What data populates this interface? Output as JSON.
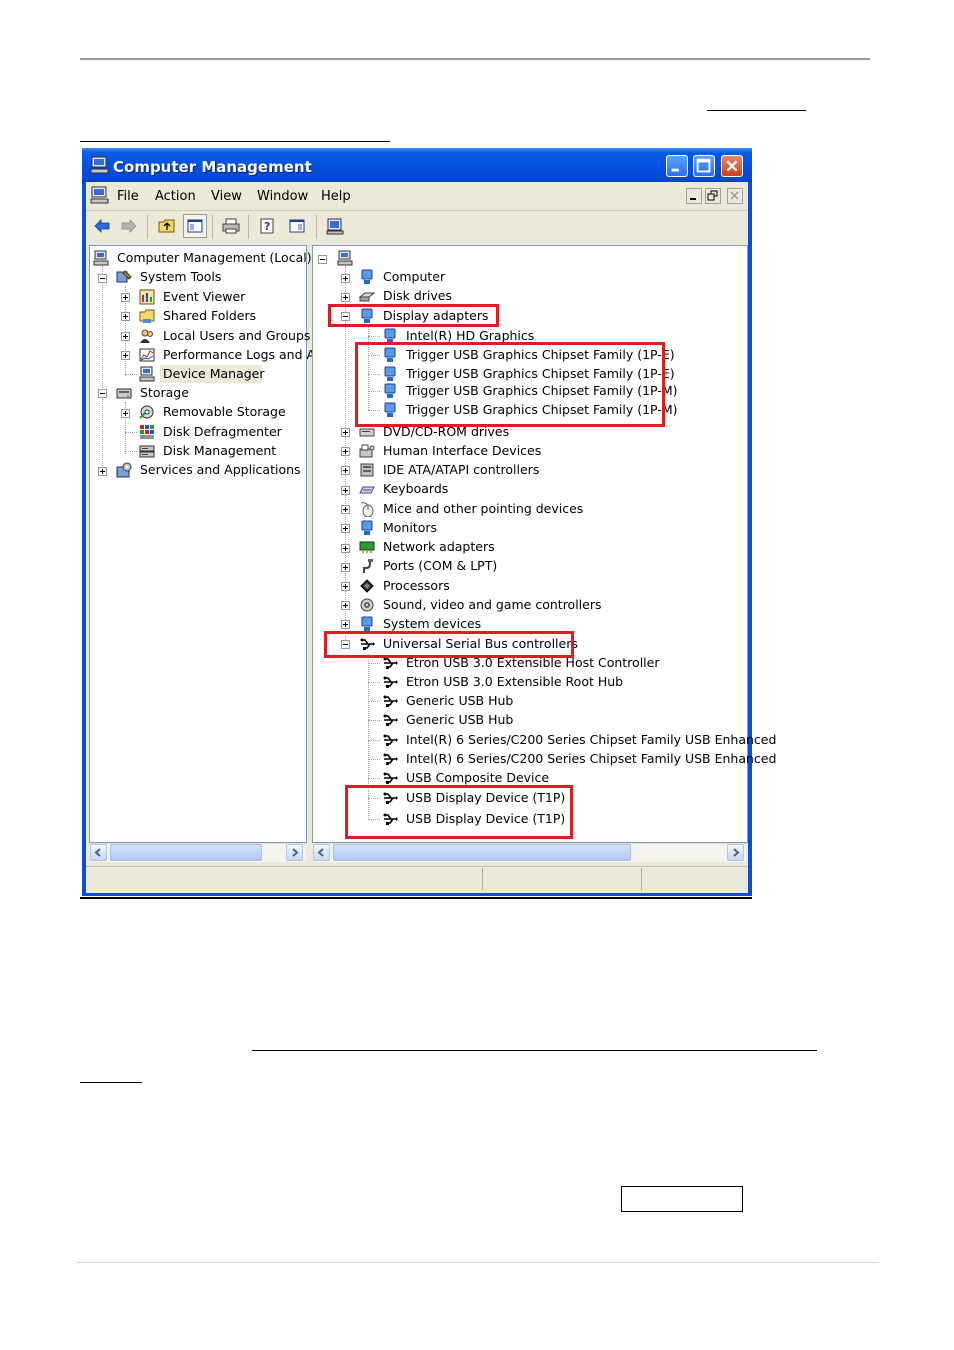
{
  "window": {
    "title": "Computer Management",
    "colors": {
      "titlebar": "#0551e0",
      "highlight_box": "#e01b24",
      "client": "#ece9d8"
    }
  },
  "menu": {
    "file": "File",
    "action": "Action",
    "view": "View",
    "window": "Window",
    "help": "Help"
  },
  "toolbar": {
    "icons": [
      "back-arrow-icon",
      "forward-arrow-icon",
      "up-folder-icon",
      "show-hide-tree-icon",
      "print-icon",
      "help-icon",
      "show-hide-action-pane-icon",
      "properties-icon"
    ]
  },
  "left_tree": [
    {
      "label": "Computer Management (Local)",
      "icon": "computer-management-icon"
    },
    {
      "label": "System Tools",
      "icon": "system-tools-icon"
    },
    {
      "label": "Event Viewer",
      "icon": "event-viewer-icon"
    },
    {
      "label": "Shared Folders",
      "icon": "shared-folders-icon"
    },
    {
      "label": "Local Users and Groups",
      "icon": "users-icon"
    },
    {
      "label": "Performance Logs and A",
      "icon": "performance-icon"
    },
    {
      "label": "Device Manager",
      "icon": "device-manager-icon",
      "selected": true
    },
    {
      "label": "Storage",
      "icon": "storage-icon"
    },
    {
      "label": "Removable Storage",
      "icon": "removable-storage-icon"
    },
    {
      "label": "Disk Defragmenter",
      "icon": "defrag-icon"
    },
    {
      "label": "Disk Management",
      "icon": "disk-management-icon"
    },
    {
      "label": "Services and Applications",
      "icon": "services-icon"
    }
  ],
  "device_tree": {
    "root_icon": "computer-root-icon",
    "categories_top": [
      {
        "label": "Computer",
        "icon": "computer-icon"
      },
      {
        "label": "Disk drives",
        "icon": "disk-drive-icon"
      }
    ],
    "display_adapters": {
      "label": "Display adapters",
      "icon": "display-adapter-icon",
      "children": [
        "Intel(R) HD Graphics",
        "Trigger USB Graphics Chipset Family (1P-E)",
        "Trigger USB Graphics Chipset Family (1P-E)",
        "Trigger USB Graphics Chipset Family (1P-M)",
        "Trigger USB Graphics Chipset Family (1P-M)"
      ]
    },
    "categories_mid": [
      {
        "label": "DVD/CD-ROM drives",
        "icon": "dvd-icon"
      },
      {
        "label": "Human Interface Devices",
        "icon": "hid-icon"
      },
      {
        "label": "IDE ATA/ATAPI controllers",
        "icon": "ide-icon"
      },
      {
        "label": "Keyboards",
        "icon": "keyboard-icon"
      },
      {
        "label": "Mice and other pointing devices",
        "icon": "mouse-icon"
      },
      {
        "label": "Monitors",
        "icon": "monitor-icon"
      },
      {
        "label": "Network adapters",
        "icon": "network-icon"
      },
      {
        "label": "Ports (COM & LPT)",
        "icon": "port-icon"
      },
      {
        "label": "Processors",
        "icon": "processor-icon"
      },
      {
        "label": "Sound, video and game controllers",
        "icon": "sound-icon"
      },
      {
        "label": "System devices",
        "icon": "system-device-icon"
      }
    ],
    "usb_controllers": {
      "label": "Universal Serial Bus controllers",
      "icon": "usb-icon",
      "children": [
        "Etron USB 3.0 Extensible Host Controller",
        "Etron USB 3.0 Extensible Root Hub",
        "Generic USB Hub",
        "Generic USB Hub",
        "Intel(R) 6 Series/C200 Series Chipset Family USB Enhanced",
        "Intel(R) 6 Series/C200 Series Chipset Family USB Enhanced",
        "USB Composite Device",
        "USB Display Device (T1P)",
        "USB Display Device (T1P)"
      ]
    }
  }
}
